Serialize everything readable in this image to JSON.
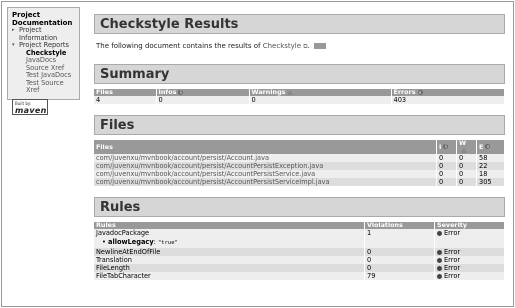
{
  "sidebar": {
    "heading": "Project Documentation",
    "items": [
      {
        "label": "Project Information"
      },
      {
        "label": "Project Reports"
      }
    ],
    "subitems": [
      {
        "label": "Checkstyle"
      },
      {
        "label": "JavaDocs"
      },
      {
        "label": "Source Xref"
      },
      {
        "label": "Test JavaDocs"
      },
      {
        "label": "Test Source Xref"
      }
    ],
    "built_by_small": "Built by:",
    "built_by_logo": "maven"
  },
  "main": {
    "title": "Checkstyle Results",
    "intro_text": "The following document contains the results of",
    "intro_link": "Checkstyle",
    "summary_title": "Summary",
    "summary_headers": {
      "files": "Files",
      "infos": "Infos",
      "warnings": "Warnings",
      "errors": "Errors"
    },
    "summary_values": {
      "files": "4",
      "infos": "0",
      "warnings": "0",
      "errors": "403"
    },
    "files_title": "Files",
    "files_headers": {
      "files": "Files",
      "i": "I",
      "w": "W",
      "e": "E"
    },
    "files_rows": [
      {
        "path": "com/juvenxu/mvnbook/account/persist/Account.java",
        "i": "0",
        "w": "0",
        "e": "58"
      },
      {
        "path": "com/juvenxu/mvnbook/account/persist/AccountPersistException.java",
        "i": "0",
        "w": "0",
        "e": "22"
      },
      {
        "path": "com/juvenxu/mvnbook/account/persist/AccountPersistService.java",
        "i": "0",
        "w": "0",
        "e": "18"
      },
      {
        "path": "com/juvenxu/mvnbook/account/persist/AccountPersistServiceImpl.java",
        "i": "0",
        "w": "0",
        "e": "305"
      }
    ],
    "rules_title": "Rules",
    "rules_headers": {
      "rules": "Rules",
      "violations": "Violations",
      "severity": "Severity"
    },
    "rules_rows": [
      {
        "rule": "JavadocPackage",
        "violations": "1",
        "severity": "Error"
      },
      {
        "rule": "NewlineAtEndOfFile",
        "violations": "0",
        "severity": "Error"
      },
      {
        "rule": "Translation",
        "violations": "0",
        "severity": "Error"
      },
      {
        "rule": "FileLength",
        "violations": "0",
        "severity": "Error"
      },
      {
        "rule": "FileTabCharacter",
        "violations": "79",
        "severity": "Error"
      }
    ],
    "rule_property": {
      "name": "allowLegacy",
      "value": "\"true\""
    }
  }
}
